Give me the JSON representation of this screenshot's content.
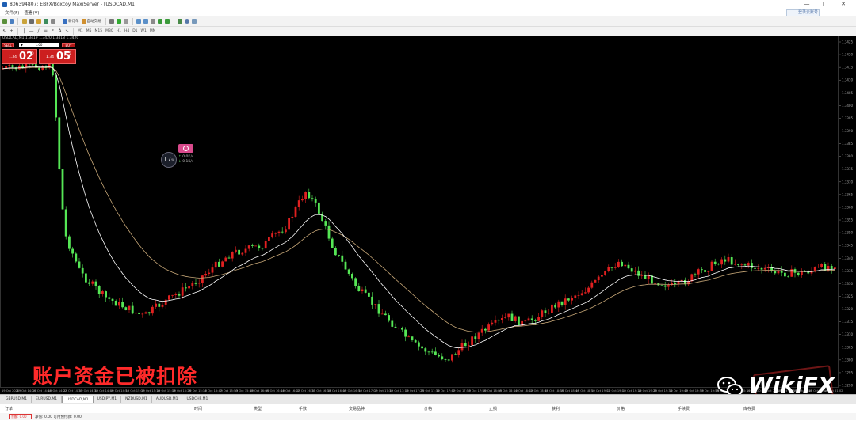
{
  "window": {
    "title": "806394807: EBFX/Boxcoy MaxiServer - [USDCAD,M1]",
    "minimize": "—",
    "maximize": "□",
    "close": "✕"
  },
  "menu": {
    "items": [
      "文件(F)",
      "查看(V)"
    ],
    "signin": "登录云账号"
  },
  "toolbar1": {
    "new_order": "新订单",
    "auto_trading": "自动交易"
  },
  "toolbar2": {
    "timeframes": [
      "M1",
      "M5",
      "M15",
      "M30",
      "H1",
      "H4",
      "D1",
      "W1",
      "MN"
    ]
  },
  "chart": {
    "header": "USDCAD,M1  1.3419 1.3420 1.3418 1.3420",
    "price_labels": [
      "1.3425",
      "1.3420",
      "1.3415",
      "1.3410",
      "1.3405",
      "1.3400",
      "1.3395",
      "1.3390",
      "1.3385",
      "1.3380",
      "1.3375",
      "1.3370",
      "1.3365",
      "1.3360",
      "1.3355",
      "1.3350",
      "1.3345",
      "1.3340",
      "1.3335",
      "1.3330",
      "1.3325",
      "1.3320",
      "1.3315",
      "1.3310",
      "1.3305",
      "1.3300",
      "1.3295",
      "1.3290"
    ],
    "time_labels": [
      "19 Oct 2020",
      "19 Oct 14:06",
      "19 Oct 14:14",
      "19 Oct 14:22",
      "19 Oct 14:30",
      "19 Oct 14:38",
      "19 Oct 14:46",
      "19 Oct 14:54",
      "19 Oct 15:02",
      "19 Oct 15:10",
      "19 Oct 15:18",
      "19 Oct 15:26",
      "19 Oct 15:34",
      "19 Oct 15:42",
      "19 Oct 15:50",
      "19 Oct 15:58",
      "19 Oct 16:06",
      "19 Oct 16:14",
      "19 Oct 16:22",
      "19 Oct 16:30",
      "19 Oct 16:38",
      "19 Oct 16:46",
      "19 Oct 16:54",
      "19 Oct 17:02",
      "19 Oct 17:10",
      "19 Oct 17:18",
      "19 Oct 17:26",
      "19 Oct 17:34",
      "19 Oct 17:42",
      "19 Oct 17:50",
      "19 Oct 17:58",
      "19 Oct 18:06",
      "19 Oct 18:14",
      "19 Oct 18:22",
      "19 Oct 18:30",
      "19 Oct 18:38",
      "19 Oct 18:46",
      "19 Oct 18:54",
      "19 Oct 19:02",
      "19 Oct 19:10",
      "19 Oct 19:18",
      "19 Oct 19:26",
      "19 Oct 19:34",
      "19 Oct 19:42",
      "19 Oct 19:50",
      "19 Oct 19:58",
      "19 Oct 20:06",
      "19 Oct 20:14",
      "19 Oct 20:22",
      "19 Oct 20:30",
      "19 Oct 20:38",
      "19 Oct 20:46",
      "19 Oct 20:54",
      "19 Oct 21:02"
    ],
    "bull_color": "#e02020",
    "bear_color": "#55e655",
    "ma_fast_color": "#ffffff",
    "ma_slow_color": "#c8a878"
  },
  "one_click": {
    "sell_label": "SELL",
    "buy_label": "BUY",
    "lot": "1.00",
    "lot_arrow": "▼",
    "sell_prefix": "1.34",
    "sell_big": "02",
    "sell_pip": "0",
    "buy_prefix": "1.34",
    "buy_big": "05",
    "buy_pip": "5"
  },
  "widget": {
    "gauge_value": "17",
    "gauge_unit": "%",
    "stat_up": "0.0K/s",
    "stat_down": "0.1K/s"
  },
  "overlay_text": "账户资金已被扣除",
  "watermark": {
    "text": "WikiFX"
  },
  "tabs": [
    "GBPUSD,M1",
    "EURUSD,M1",
    "USDCAD,M1",
    "USDJPY,M1",
    "NZDUSD,M1",
    "AUDUSD,M1",
    "USDCHF,M1"
  ],
  "active_tab": 2,
  "terminal": {
    "headers": [
      "订单",
      "时间",
      "类型",
      "手数",
      "交易品种",
      "价格",
      "止损",
      "获利",
      "价格",
      "手续费",
      "库存费"
    ],
    "balance_tag": "余额: 0.00",
    "row_text": "净值: 0.00   可用预付款: 0.00"
  }
}
